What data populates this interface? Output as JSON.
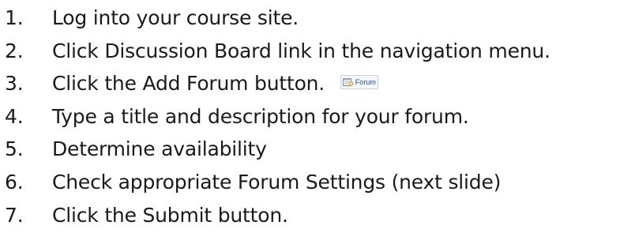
{
  "steps": [
    {
      "number": "1.",
      "text": "Log into your course site."
    },
    {
      "number": "2.",
      "text": "Click Discussion Board link in the navigation menu."
    },
    {
      "number": "3.",
      "text": "Click the Add Forum button."
    },
    {
      "number": "4.",
      "text": "Type a title and description for your forum."
    },
    {
      "number": "5.",
      "text": "Determine availability"
    },
    {
      "number": "6.",
      "text": "Check appropriate Forum Settings (next slide)"
    },
    {
      "number": "7.",
      "text": "Click the Submit button."
    }
  ],
  "forum_button": {
    "label": "Forum",
    "icon": "add-forum-icon"
  },
  "colors": {
    "text": "#1a1a1a",
    "button_text": "#1c4f9c",
    "icon_accent": "#e8a33a"
  }
}
